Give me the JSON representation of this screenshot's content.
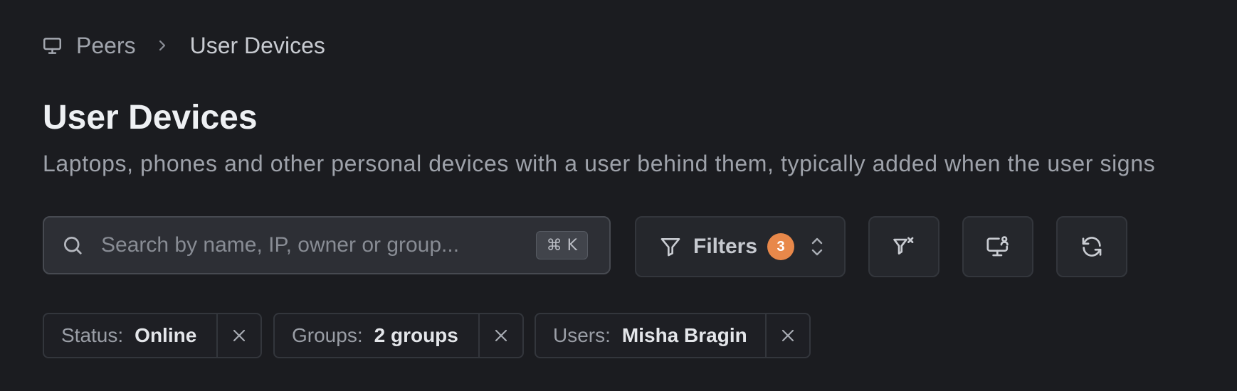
{
  "breadcrumb": {
    "icon": "monitor-icon",
    "parent_label": "Peers",
    "separator_icon": "chevron-right-icon",
    "current_label": "User Devices"
  },
  "header": {
    "title": "User Devices",
    "description": "Laptops, phones and other personal devices with a user behind them, typically added when the user signs"
  },
  "toolbar": {
    "search": {
      "icon": "search-icon",
      "placeholder": "Search by name, IP, owner or group...",
      "value": "",
      "shortcut": "⌘ K"
    },
    "filters": {
      "icon": "filter-icon",
      "label": "Filters",
      "count": "3",
      "chevron_icon": "chevron-up-down-icon"
    },
    "clear_filters_icon": "filter-clear-icon",
    "device_user_icon": "monitor-user-icon",
    "refresh_icon": "refresh-icon"
  },
  "active_filters": [
    {
      "key": "Status:",
      "value": "Online",
      "remove_icon": "close-icon"
    },
    {
      "key": "Groups:",
      "value": "2 groups",
      "remove_icon": "close-icon"
    },
    {
      "key": "Users:",
      "value": "Misha Bragin",
      "remove_icon": "close-icon"
    }
  ],
  "colors": {
    "background": "#1b1c20",
    "badge": "#e8884a",
    "surface": "#25272c",
    "border": "#33363c"
  }
}
